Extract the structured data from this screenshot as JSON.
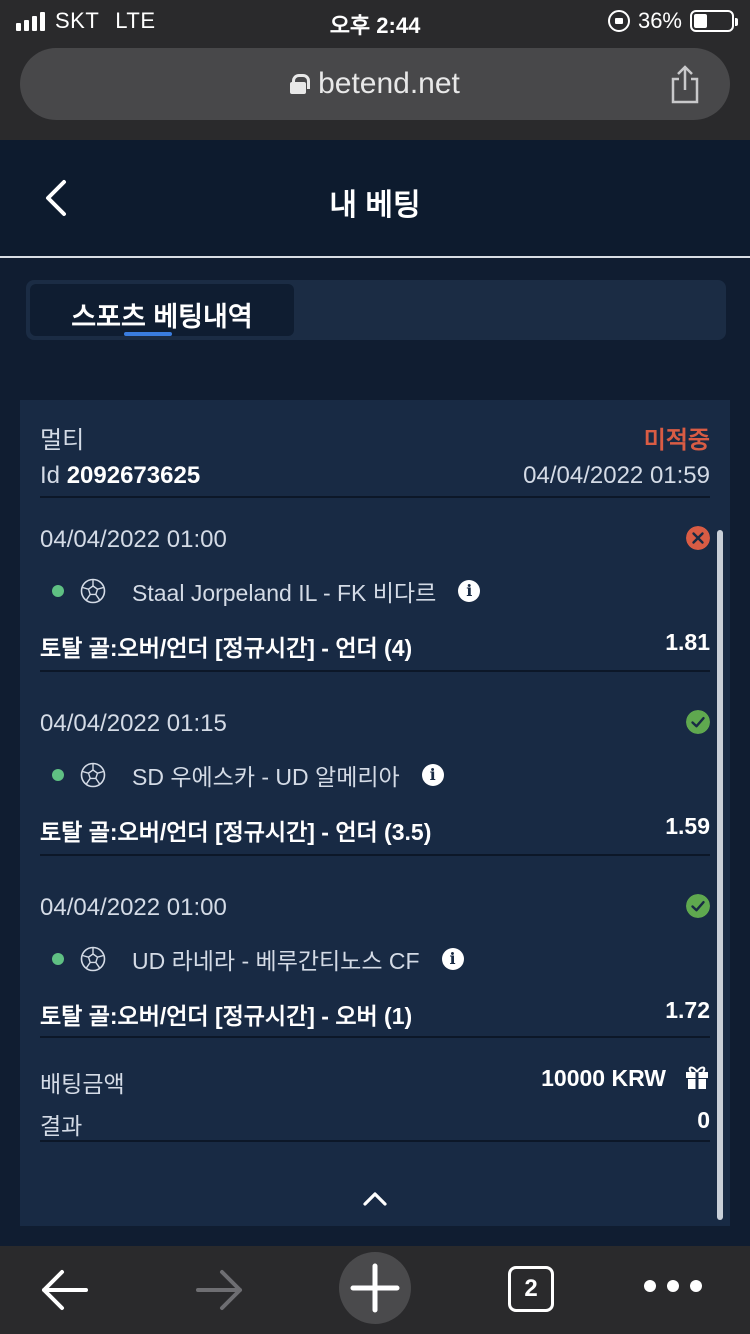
{
  "status_bar": {
    "carrier": "SKT",
    "network": "LTE",
    "time": "오후 2:44",
    "battery": "36%"
  },
  "browser": {
    "url": "betend.net",
    "tab_count": "2"
  },
  "header": {
    "title": "내 베팅"
  },
  "tabs": [
    {
      "label": "스포츠 베팅내역",
      "active": true
    }
  ],
  "bet": {
    "type": "멀티",
    "status": "미적중",
    "id_label": "Id",
    "id": "2092673625",
    "created": "04/04/2022 01:59",
    "legs": [
      {
        "date": "04/04/2022 01:00",
        "match": "Staal Jorpeland IL - FK 비다르",
        "market": "토탈 골:오버/언더 [정규시간] - 언더 (4)",
        "odds": "1.81",
        "result": "lost"
      },
      {
        "date": "04/04/2022 01:15",
        "match": "SD 우에스카 - UD 알메리아",
        "market": "토탈 골:오버/언더 [정규시간] - 언더 (3.5)",
        "odds": "1.59",
        "result": "won"
      },
      {
        "date": "04/04/2022 01:00",
        "match": "UD 라네라 - 베루간티노스 CF",
        "market": "토탈 골:오버/언더 [정규시간] - 오버 (1)",
        "odds": "1.72",
        "result": "won"
      }
    ],
    "stake_label": "배팅금액",
    "stake": "10000 KRW",
    "result_label": "결과",
    "result": "0"
  },
  "colors": {
    "lost": "#d95c44",
    "won": "#5fa84f",
    "live_dot": "#5fc083",
    "accent": "#3a7de0"
  },
  "icons": {
    "back": "chevron-left-icon",
    "collapse": "chevron-up-icon",
    "gift": "gift-icon",
    "info": "info-icon",
    "sport": "soccer-ball-icon"
  }
}
